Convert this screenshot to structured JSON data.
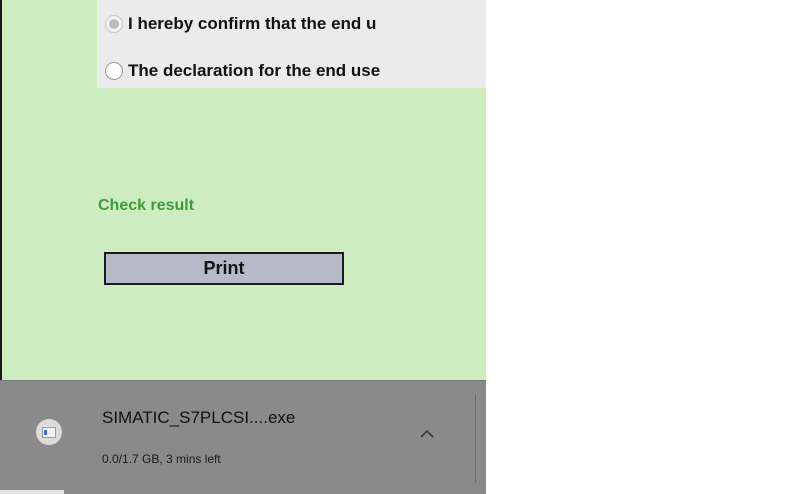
{
  "declaration": {
    "options": [
      {
        "label": "I hereby confirm that the end u",
        "selected": true,
        "disabled": true
      },
      {
        "label": "The declaration for the end use",
        "selected": false,
        "disabled": false
      }
    ]
  },
  "check_result": {
    "label": "Check result"
  },
  "print_button": {
    "label": "Print"
  },
  "download_bar": {
    "file_name": "SIMATIC_S7PLCSI....exe",
    "status": "0.0/1.7 GB, 3 mins left",
    "file_icon": "file-icon",
    "expand_icon": "chevron-up-icon"
  },
  "colors": {
    "content_background": "#cdedc0",
    "check_result_text": "#3c9c3c",
    "print_button_bg": "#b8b9c6",
    "download_bar_bg": "#8a8a8a"
  }
}
